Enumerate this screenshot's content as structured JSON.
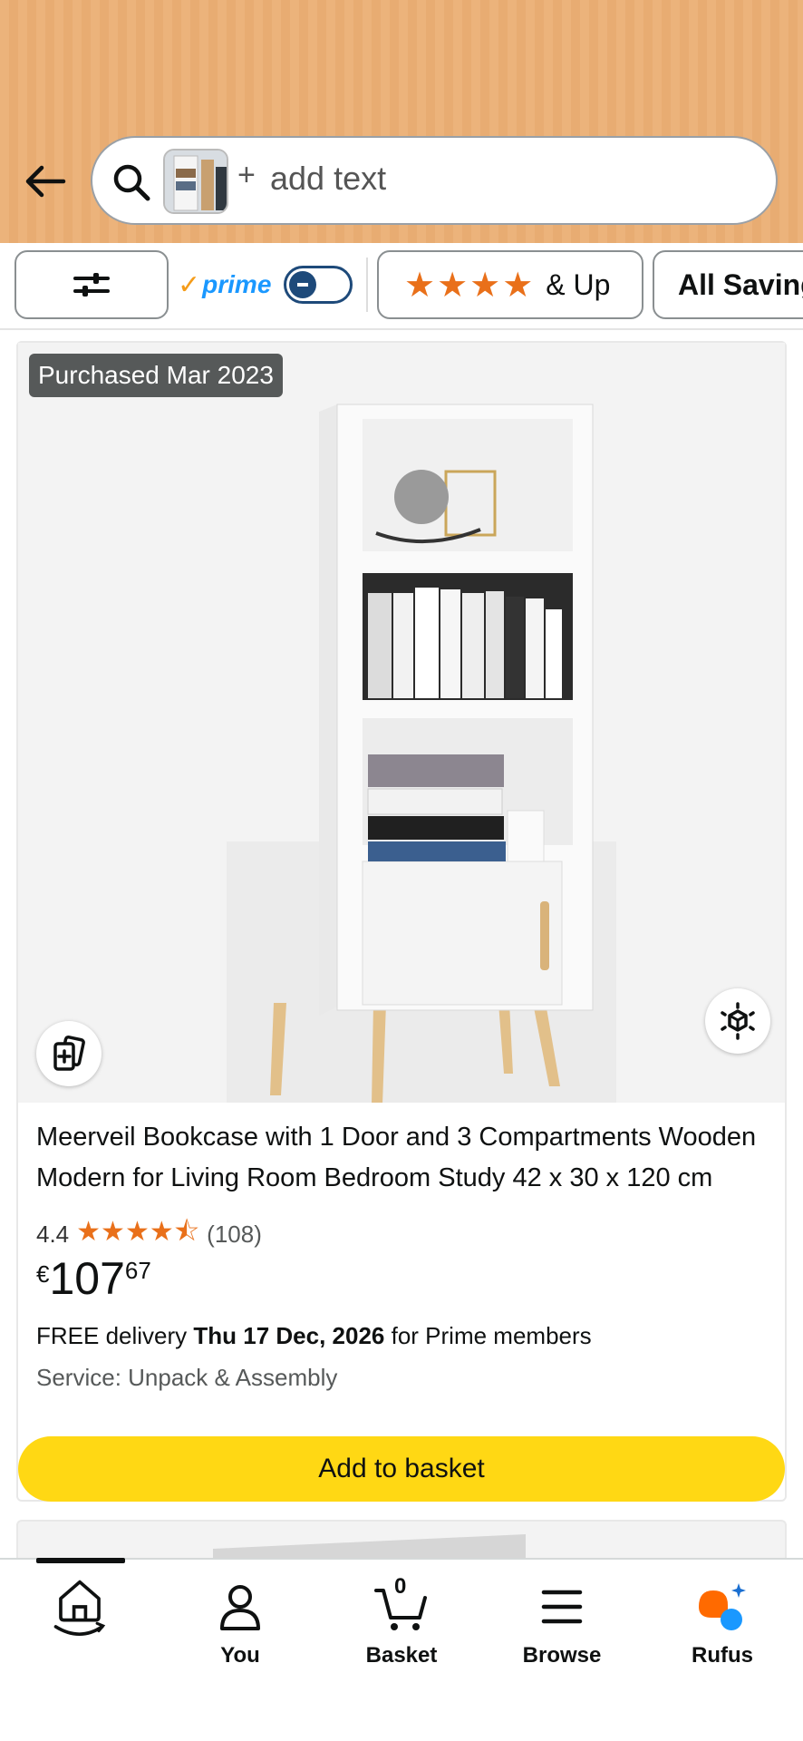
{
  "header": {
    "search_placeholder": "add text",
    "plus": "+"
  },
  "filters": {
    "prime_label": "prime",
    "prime_check": "✓",
    "prime_toggle_on": false,
    "stars_chip_stars": "★★★★",
    "stars_chip_label": "& Up",
    "savings_chip_label": "All Savings"
  },
  "product": {
    "purchased_badge": "Purchased Mar 2023",
    "title": "Meerveil Bookcase with 1 Door and 3 Compartments Wooden Modern for Living Room Bedroom Study 42 x 30 x 120 cm",
    "rating_value": "4.4",
    "rating_stars": "★★★★⯪",
    "rating_count": "(108)",
    "price_currency": "€",
    "price_whole": "107",
    "price_fraction": "67",
    "delivery_prefix": "FREE delivery ",
    "delivery_date": "Thu 17 Dec, 2026",
    "delivery_suffix": " for Prime members",
    "service": "Service: Unpack & Assembly",
    "add_button": "Add to basket"
  },
  "nav": {
    "items": [
      {
        "label": "",
        "icon": "home-icon"
      },
      {
        "label": "You",
        "icon": "person-icon"
      },
      {
        "label": "Basket",
        "icon": "cart-icon",
        "count": "0"
      },
      {
        "label": "Browse",
        "icon": "menu-icon"
      },
      {
        "label": "Rufus",
        "icon": "rufus-icon"
      }
    ]
  },
  "colors": {
    "header_bg": "#ecb37b",
    "accent_star": "#e9701a",
    "prime_blue": "#1a98ff",
    "add_button": "#ffd814"
  }
}
